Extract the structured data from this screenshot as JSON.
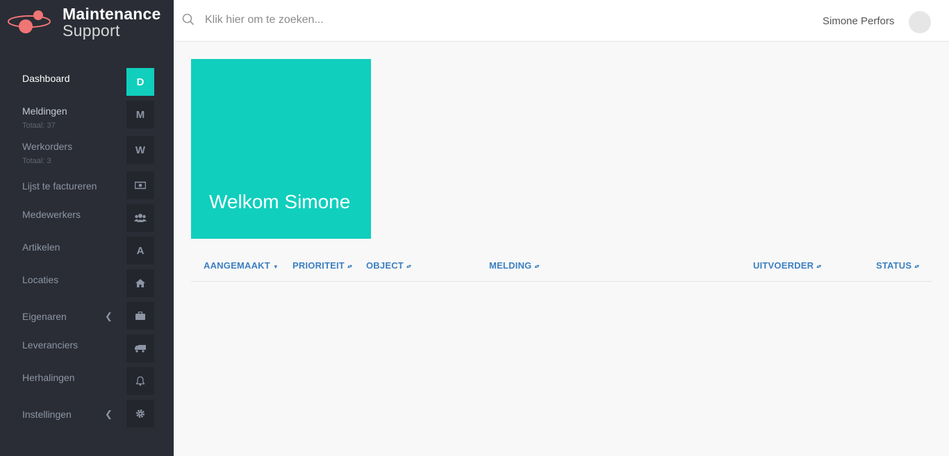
{
  "brand": {
    "line1": "Maintenance",
    "line2": "Support",
    "accent": "#f07575"
  },
  "search": {
    "placeholder": "Klik hier om te zoeken..."
  },
  "user": {
    "name": "Simone Perfors"
  },
  "nav": [
    {
      "label": "Dashboard",
      "tile": "D",
      "active": true
    },
    {
      "label": "Meldingen",
      "sub": "Totaal: 37",
      "tile": "M"
    },
    {
      "label": "Werkorders",
      "sub": "Totaal: 3",
      "tile": "W"
    },
    {
      "label": "Lijst te factureren",
      "icon": "money-icon"
    },
    {
      "label": "Medewerkers",
      "icon": "users-icon"
    },
    {
      "label": "Artikelen",
      "tile": "A"
    },
    {
      "label": "Locaties",
      "icon": "home-icon"
    },
    {
      "label": "Eigenaren",
      "icon": "briefcase-icon",
      "expandable": true
    },
    {
      "label": "Leveranciers",
      "icon": "truck-icon"
    },
    {
      "label": "Herhalingen",
      "icon": "bell-icon"
    },
    {
      "label": "Instellingen",
      "icon": "gear-icon",
      "expandable": true
    }
  ],
  "welcome": {
    "text": "Welkom Simone",
    "color": "#10cfbd"
  },
  "table": {
    "columns": [
      "AANGEMAAKT",
      "PRIORITEIT",
      "OBJECT",
      "MELDING",
      "UITVOERDER",
      "STATUS"
    ],
    "sorted_column": "AANGEMAAKT",
    "rows": []
  }
}
